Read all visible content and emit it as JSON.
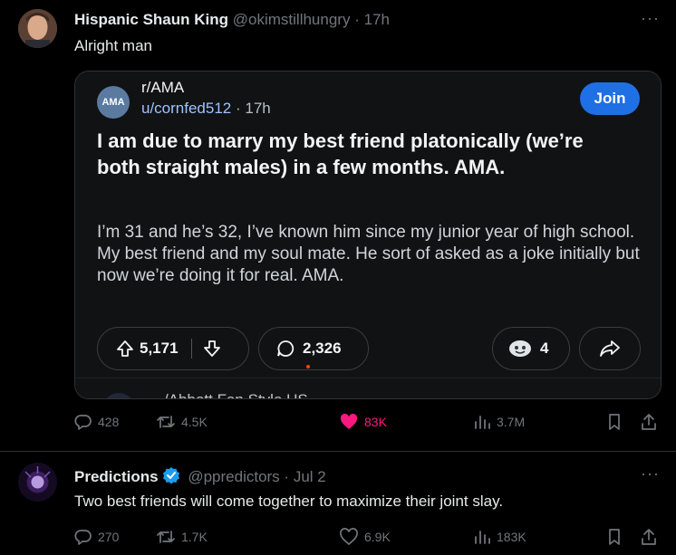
{
  "tweet1": {
    "author_name": "Hispanic Shaun King",
    "author_handle": "@okimstillhungry",
    "separator": "·",
    "time": "17h",
    "text": "Alright man",
    "more_glyph": "···",
    "embed": {
      "subreddit": "r/AMA",
      "subreddit_icon_text": "AMA",
      "user": "u/cornfed512",
      "separator": "·",
      "time": "17h",
      "join_label": "Join",
      "title": "I am due to marry my best friend platonically (we’re both straight males) in a few months. AMA.",
      "body": "I’m 31 and he’s 32, I’ve known him since my junior year of high school. My best friend and my soul mate. He sort of asked as a joke initially but now we’re doing it for real. AMA.",
      "upvotes": "5,171",
      "comments": "2,326",
      "awards": "4",
      "next_comment_preview": "/Abbott Fan Style US"
    },
    "stats": {
      "replies": "428",
      "retweets": "4.5K",
      "likes": "83K",
      "views": "3.7M",
      "like_color": "#f91880"
    }
  },
  "tweet2": {
    "author_name": "Predictions",
    "author_handle": "@ppredictors",
    "separator": "·",
    "time": "Jul 2",
    "text": "Two best friends will come together to maximize their joint slay.",
    "more_glyph": "···",
    "verified_color": "#1d9bf0",
    "stats": {
      "replies": "270",
      "retweets": "1.7K",
      "likes": "6.9K",
      "views": "183K"
    }
  },
  "icons": [
    "reply-icon",
    "retweet-icon",
    "heart-icon",
    "views-icon",
    "bookmark-icon",
    "share-icon",
    "upvote-icon",
    "downvote-icon",
    "comment-icon",
    "award-icon",
    "reddit-share-icon",
    "verified-icon",
    "more-icon"
  ]
}
